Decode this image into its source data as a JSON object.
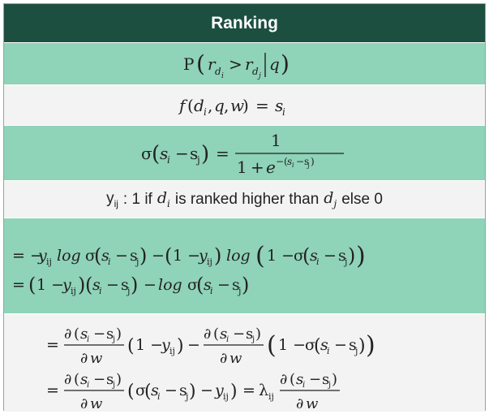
{
  "header": {
    "title": "Ranking"
  },
  "rows": [
    {
      "id": "pairwise-probability",
      "text": "P(r_{d_i} > r_{d_j} | q)"
    },
    {
      "id": "score-function",
      "text": "f(d_i, q, w) = s_i"
    },
    {
      "id": "sigmoid-definition",
      "text": "σ(s_i − s_j) = 1 / (1 + e^{−(s_i − s_j)})"
    },
    {
      "id": "label-definition",
      "yij": "y",
      "yij_sub": "ij",
      "t1": ": 1 if",
      "di": "d",
      "di_sub": "i",
      "t2": "is ranked higher than",
      "dj": "d",
      "dj_sub": "j",
      "t3": "else 0"
    },
    {
      "id": "loss-expression",
      "line1": "= −y_ij log σ(s_i − s_j) − (1 − y_ij) log(1 − σ(s_i − s_j))",
      "line2": "= (1 − y_ij)(s_i − s_j) − log σ(s_i − s_j)"
    },
    {
      "id": "gradient-expression",
      "line1": "= ∂(s_i − s_j)/∂w (1 − y_ij) − ∂(s_i − s_j)/∂w (1 − σ(s_i − s_j))",
      "line2": "= ∂(s_i − s_j)/∂w (σ(s_i − s_j) − y_ij) = λ_ij ∂(s_i − s_j)/∂w"
    }
  ],
  "colors": {
    "header": "#1c4f3f",
    "row_green": "#8fd3b8",
    "row_white": "#f3f3f3"
  }
}
